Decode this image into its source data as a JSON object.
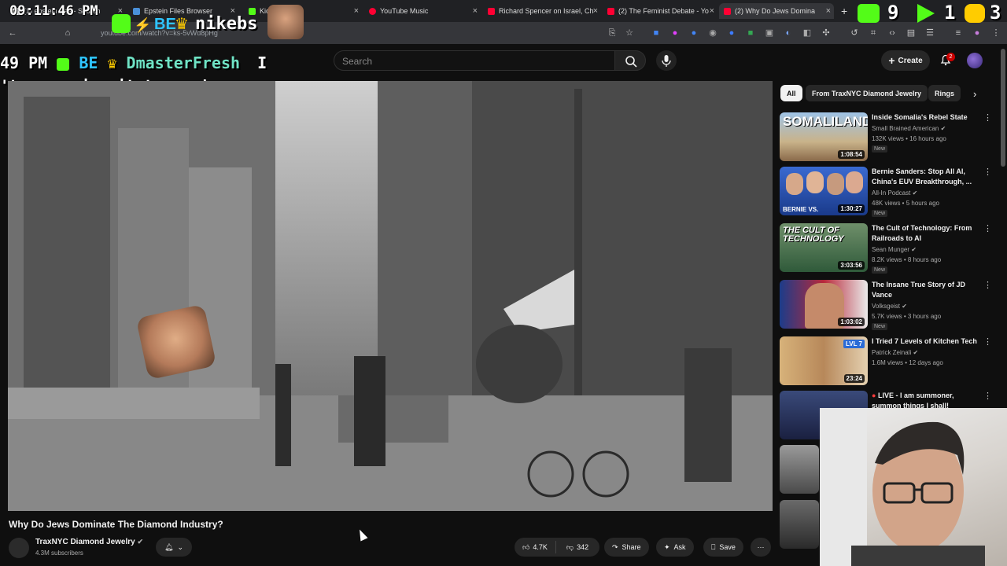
{
  "browser": {
    "tabs": [
      {
        "title": "(1) epstein files - Search",
        "color": "#ffffff"
      },
      {
        "title": "Epstein Files Browser",
        "color": "#4a90d9"
      },
      {
        "title": "Kick",
        "color": "#53fc18"
      },
      {
        "title": "YouTube Music",
        "color": "#ff0033"
      },
      {
        "title": "Richard Spencer on Israel, Ch",
        "color": "#ff0033"
      },
      {
        "title": "(2) The Feminist Debate - Yo",
        "color": "#ff0033"
      },
      {
        "title": "(2) Why Do Jews Domina",
        "color": "#ff0033"
      }
    ],
    "url": "youtube.com/watch?v=ks-5vWd8pHg"
  },
  "overlay": {
    "clock": "09:11:46 PM",
    "stream_name": "nikebs",
    "chat_time": "49 PM",
    "chat_user": "DmasterFresh",
    "chat_cursor": "I",
    "chat_message": "'t even give it to my dog",
    "counter_a": "9",
    "counter_b": "1",
    "counter_c": "3"
  },
  "header": {
    "search_placeholder": "Search",
    "create_label": "Create",
    "notification_count": "2"
  },
  "video": {
    "title": "Why Do Jews Dominate The Diamond Industry?",
    "channel": "TraxNYC Diamond Jewelry",
    "subscribers": "4.3M subscribers",
    "likes": "4.7K",
    "dislikes": "342",
    "share_label": "Share",
    "ask_label": "Ask",
    "save_label": "Save"
  },
  "sidebar": {
    "chips": [
      "All",
      "From TraxNYC Diamond Jewelry",
      "Rings"
    ],
    "recommendations": [
      {
        "title": "Inside Somalia's Rebel State",
        "channel": "Small Brained American",
        "meta": "132K views • 16 hours ago",
        "badge": "New",
        "duration": "1:08:54",
        "thumb_text": "SOMALILAND",
        "thumb_color": "#b89a6a"
      },
      {
        "title": "Bernie Sanders: Stop All AI, China's EUV Breakthrough, ...",
        "channel": "All-In Podcast",
        "meta": "48K views • 5 hours ago",
        "badge": "New",
        "duration": "1:30:27",
        "thumb_text": "BERNIE VS.",
        "thumb_color": "#1a3a8a"
      },
      {
        "title": "The Cult of Technology: From Railroads to AI",
        "channel": "Sean Munger",
        "meta": "8.2K views • 8 hours ago",
        "badge": "New",
        "duration": "3:03:56",
        "thumb_text": "THE CULT OF TECHNOLOGY",
        "thumb_color": "#2f5a3a"
      },
      {
        "title": "The Insane True Story of JD Vance",
        "channel": "Volksgeist",
        "meta": "5.7K views • 3 hours ago",
        "badge": "New",
        "duration": "1:03:02",
        "thumb_text": "",
        "thumb_color": "#5a3a3a"
      },
      {
        "title": "I Tried 7 Levels of Kitchen Tech",
        "channel": "Patrick Zeinali",
        "meta": "1.6M views • 12 days ago",
        "badge": "",
        "duration": "23:24",
        "thumb_text": "LVL 7",
        "thumb_color": "#c9a36a"
      },
      {
        "title": "LIVE - I am summoner, summon things I shall!",
        "channel": "",
        "meta": "",
        "badge": "",
        "duration": "",
        "thumb_text": "",
        "thumb_color": "#4a5a8a"
      }
    ]
  }
}
